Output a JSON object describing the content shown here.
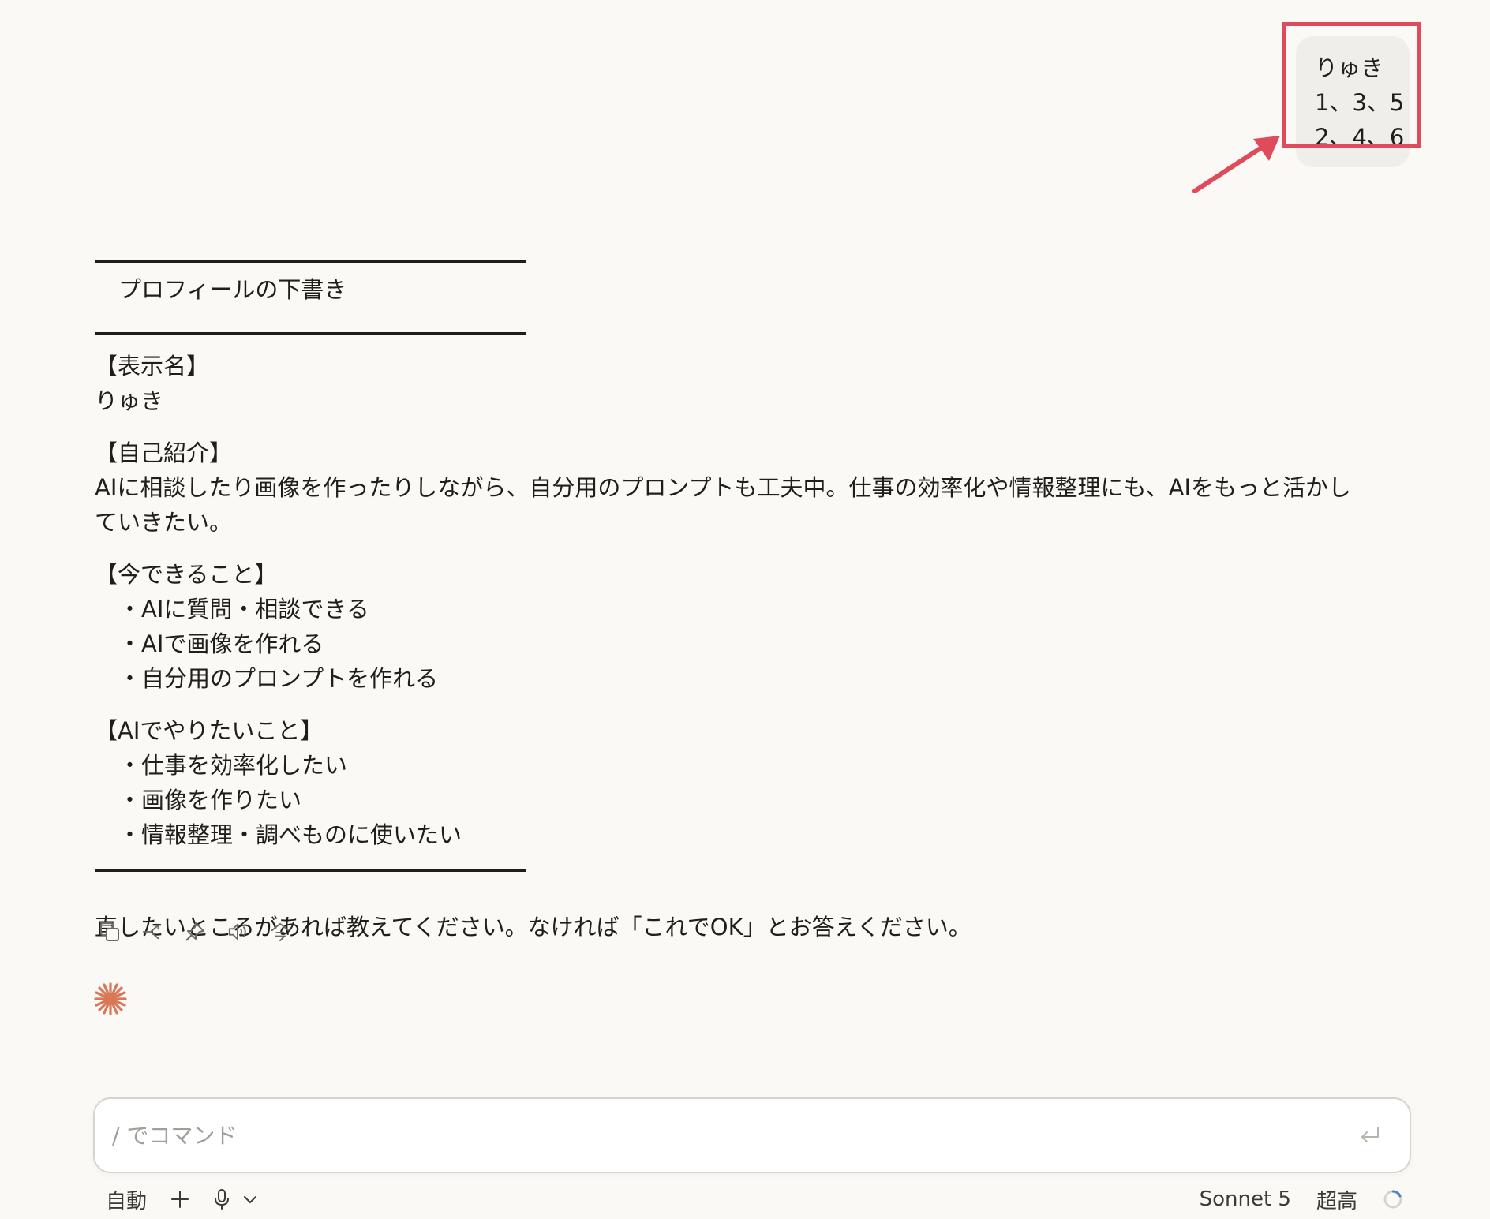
{
  "user_message": {
    "lines": [
      "りゅき",
      "1、3、5",
      "2、4、6"
    ]
  },
  "reply": {
    "draft_title": "プロフィールの下書き",
    "sections": {
      "display_name": {
        "heading": "【表示名】",
        "value": "りゅき"
      },
      "intro": {
        "heading": "【自己紹介】",
        "text": "AIに相談したり画像を作ったりしながら、自分用のプロンプトも工夫中。仕事の効率化や情報整理にも、AIをもっと活かしていきたい。"
      },
      "can_do": {
        "heading": "【今できること】",
        "items": [
          "・AIに質問・相談できる",
          "・AIで画像を作れる",
          "・自分用のプロンプトを作れる"
        ]
      },
      "want": {
        "heading": "【AIでやりたいこと】",
        "items": [
          "・仕事を効率化したい",
          "・画像を作りたい",
          "・情報整理・調べものに使いたい"
        ]
      }
    },
    "closing": "直したいところがあれば教えてください。なければ「これでOK」とお答えください。"
  },
  "actions": [
    {
      "icon": "copy-icon"
    },
    {
      "icon": "branch-icon"
    },
    {
      "icon": "pin-icon"
    },
    {
      "icon": "speaker-icon"
    },
    {
      "icon": "translate-icon"
    }
  ],
  "composer": {
    "placeholder": "/ でコマンド"
  },
  "bottom_bar": {
    "mode_label": "自動",
    "model_label": "Sonnet 5",
    "effort_label": "超高"
  },
  "colors": {
    "accent": "#d97757",
    "annotation": "#e04b5c"
  }
}
